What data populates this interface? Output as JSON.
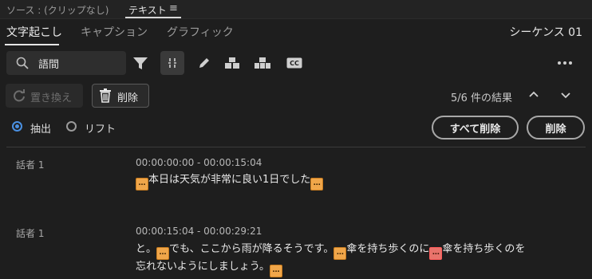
{
  "titlebar": {
    "source": "ソース : (クリップなし)",
    "panel": "テキスト",
    "menu_icon": "hamburger-menu-icon"
  },
  "tabs": [
    {
      "label": "文字起こし",
      "active": true
    },
    {
      "label": "キャプション",
      "active": false
    },
    {
      "label": "グラフィック",
      "active": false
    }
  ],
  "sequence": "シーケンス 01",
  "search": {
    "value": "語間",
    "placeholder": ""
  },
  "toolbar": {
    "icons": [
      "filter-icon",
      "merge-segments-icon",
      "pencil-icon",
      "split-segment-icon",
      "merge-clips-icon",
      "captions-icon",
      "more-icon"
    ]
  },
  "actions": {
    "replace_label": "置き換え",
    "delete_label": "削除",
    "results": "5/6 件の結果"
  },
  "mode": {
    "extract_label": "抽出",
    "lift_label": "リフト",
    "selected": "extract",
    "delete_all_label": "すべて削除",
    "delete_label": "削除"
  },
  "transcript": [
    {
      "speaker": "話者 1",
      "timecode": "00:00:00:00 - 00:00:15:04",
      "pause_marker": "…",
      "text": "本日は天気が非常に良い1日でした"
    },
    {
      "speaker": "話者 1",
      "timecode": "00:00:15:04 - 00:00:29:21",
      "pause_marker": "…",
      "line1_a": "と。",
      "line1_b": "でも、ここから雨が降るそうです。",
      "line1_c": "傘を持ち歩くのに",
      "line1_d": "傘を持ち歩くのを",
      "line2": "忘れないようにしましょう。"
    }
  ],
  "colors": {
    "background": "#1e1e1e",
    "pause_marker": "#f0a64a",
    "selected_marker": "#e8736b",
    "radio_accent": "#4a90e2"
  }
}
